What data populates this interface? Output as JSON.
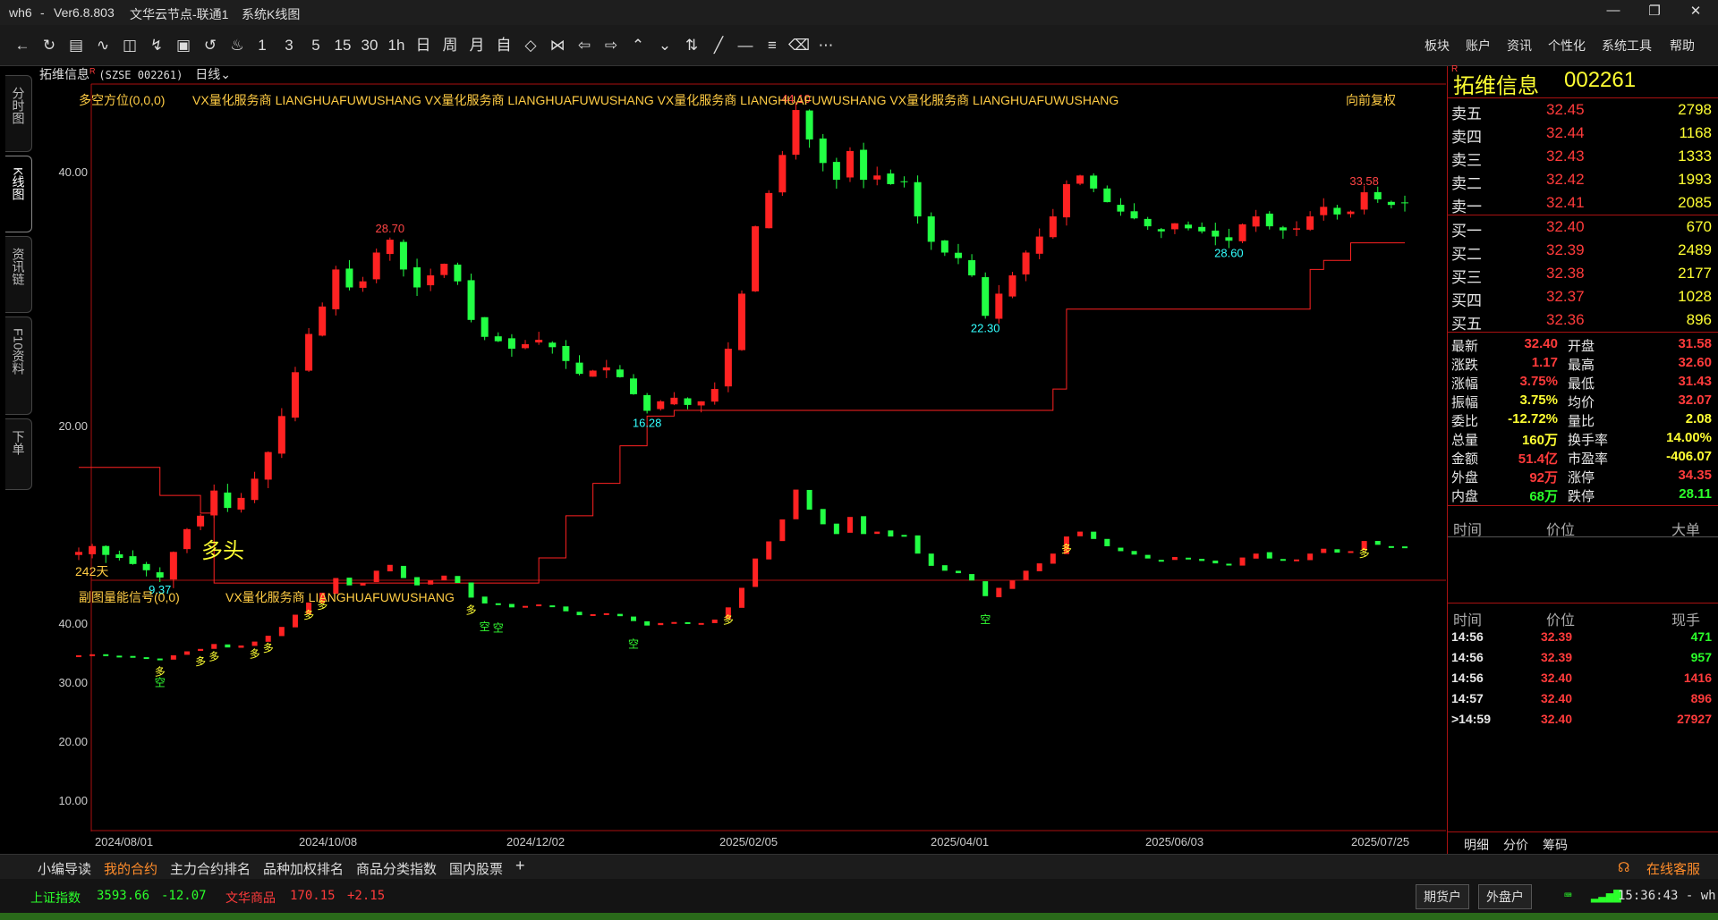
{
  "window": {
    "app": "wh6",
    "version": "Ver6.8.803",
    "node": "文华云节点-联通1",
    "view": "系统K线图",
    "min_icon": "minimize-icon",
    "max_icon": "restore-icon",
    "close_icon": "close-icon"
  },
  "toolbar": {
    "icons": [
      "back-icon",
      "refresh-icon",
      "list-icon",
      "line-chart-icon",
      "kline-icon",
      "draw-icon",
      "box-icon",
      "flash-icon",
      "bell-icon"
    ],
    "periods": [
      "1",
      "3",
      "5",
      "15",
      "30",
      "1h",
      "日",
      "周",
      "月",
      "自"
    ],
    "nav_icons": [
      "expand-icon",
      "contract-icon",
      "left-icon",
      "right-icon",
      "up-icon",
      "down-icon",
      "split-icon",
      "pen-icon",
      "minus-icon",
      "bracket-icon",
      "eraser-icon",
      "more-icon"
    ],
    "menus": [
      "板块",
      "账户",
      "资讯",
      "个性化",
      "系统工具",
      "帮助"
    ]
  },
  "sidetabs": [
    "分时图",
    "K线图",
    "资讯链",
    "F10资料",
    "下单"
  ],
  "header": {
    "name": "拓维信息",
    "flag": "R",
    "code": "(SZSE 002261)",
    "period": "日线"
  },
  "main_indicator": {
    "name": "多空方位(0,0,0)",
    "text": "VX量化服务商 LIANGHUAFUWUSHANG VX量化服务商 LIANGHUAFUWUSHANG VX量化服务商 LIANGHUAFUWUSHANG VX量化服务商 LIANGHUAFUWUSHANG",
    "right": "向前复权",
    "days": "242天",
    "signal": "多头",
    "marks": [
      "44.10",
      "28.70",
      "33.58",
      "22.30",
      "16.28",
      "28.60",
      "9.37"
    ],
    "yticks": [
      "40.00",
      "20.00"
    ]
  },
  "sub_indicator": {
    "name": "副图量能信号(0,0)",
    "text": "VX量化服务商 LIANGHUAFUWUSHANG",
    "yticks": [
      "40.00",
      "30.00",
      "20.00",
      "10.00"
    ],
    "buy": "多",
    "sell": "空"
  },
  "xaxis": [
    "2024/08/01",
    "2024/10/08",
    "2024/12/02",
    "2025/02/05",
    "2025/04/01",
    "2025/06/03",
    "2025/07/25"
  ],
  "chart_data": {
    "type": "candlestick",
    "title": "拓维信息 (SZSE 002261) 日线",
    "price_range": [
      8,
      48
    ],
    "high": 44.1,
    "low": 9.37,
    "annotations": [
      {
        "date": "2024/08",
        "value": 9.37
      },
      {
        "date": "2024/10",
        "value": 28.7
      },
      {
        "date": "2025/01",
        "value": 16.28
      },
      {
        "date": "2025/02",
        "value": 44.1
      },
      {
        "date": "2025/04",
        "value": 22.3
      },
      {
        "date": "2025/06",
        "value": 28.6
      },
      {
        "date": "2025/07",
        "value": 33.58
      }
    ],
    "xlabels": [
      "2024/08/01",
      "2024/10/08",
      "2024/12/02",
      "2025/02/05",
      "2025/04/01",
      "2025/06/03",
      "2025/07/25"
    ],
    "close_series": [
      10.2,
      10.4,
      10.1,
      10.0,
      9.8,
      9.6,
      9.37,
      10.2,
      11.0,
      11.5,
      12.5,
      11.8,
      12.2,
      13.0,
      14.2,
      16.0,
      18.5,
      21.0,
      23.0,
      26.0,
      24.5,
      25.0,
      27.5,
      28.7,
      26.0,
      24.5,
      25.5,
      26.5,
      25.0,
      22.0,
      20.8,
      20.5,
      20.0,
      20.3,
      20.6,
      20.1,
      19.2,
      18.4,
      18.6,
      18.8,
      18.2,
      17.2,
      16.28,
      16.8,
      17.0,
      16.6,
      16.8,
      17.5,
      20.0,
      24.0,
      30.0,
      33.5,
      38.0,
      44.1,
      40.0,
      37.0,
      35.0,
      38.5,
      35.0,
      35.5,
      34.5,
      34.8,
      31.0,
      28.5,
      27.5,
      27.0,
      25.5,
      22.3,
      24.0,
      25.5,
      27.5,
      29.0,
      31.0,
      34.5,
      35.5,
      34.0,
      32.5,
      31.5,
      30.8,
      30.0,
      29.5,
      30.3,
      29.8,
      29.5,
      29.0,
      28.6,
      30.2,
      31.0,
      30.0,
      29.6,
      29.8,
      31.0,
      32.0,
      31.2,
      31.5,
      33.58,
      32.8,
      32.2,
      32.4
    ],
    "stop_line": [
      {
        "d": 0,
        "v": 13.5
      },
      {
        "d": 6,
        "v": 12.3
      },
      {
        "d": 9,
        "v": 11.6
      },
      {
        "d": 10,
        "v": 9.2
      },
      {
        "d": 33,
        "v": 9.2
      },
      {
        "d": 34,
        "v": 10.0
      },
      {
        "d": 36,
        "v": 11.5
      },
      {
        "d": 38,
        "v": 12.8
      },
      {
        "d": 40,
        "v": 14.5
      },
      {
        "d": 42,
        "v": 16.0
      },
      {
        "d": 44,
        "v": 16.3
      },
      {
        "d": 70,
        "v": 16.3
      },
      {
        "d": 72,
        "v": 17.5
      },
      {
        "d": 73,
        "v": 22.8
      },
      {
        "d": 90,
        "v": 22.8
      },
      {
        "d": 91,
        "v": 26.0
      },
      {
        "d": 92,
        "v": 26.8
      },
      {
        "d": 94,
        "v": 28.4
      }
    ]
  },
  "quote": {
    "name": "拓维信息",
    "code": "002261",
    "flag": "R",
    "asks": [
      {
        "label": "卖五",
        "price": "32.45",
        "vol": "2798"
      },
      {
        "label": "卖四",
        "price": "32.44",
        "vol": "1168"
      },
      {
        "label": "卖三",
        "price": "32.43",
        "vol": "1333"
      },
      {
        "label": "卖二",
        "price": "32.42",
        "vol": "1993"
      },
      {
        "label": "卖一",
        "price": "32.41",
        "vol": "2085"
      }
    ],
    "bids": [
      {
        "label": "买一",
        "price": "32.40",
        "vol": "670"
      },
      {
        "label": "买二",
        "price": "32.39",
        "vol": "2489"
      },
      {
        "label": "买三",
        "price": "32.38",
        "vol": "2177"
      },
      {
        "label": "买四",
        "price": "32.37",
        "vol": "1028"
      },
      {
        "label": "买五",
        "price": "32.36",
        "vol": "896"
      }
    ],
    "stats": [
      {
        "l1": "最新",
        "v1": "32.40",
        "c1": "red",
        "l2": "开盘",
        "v2": "31.58",
        "c2": "red"
      },
      {
        "l1": "涨跌",
        "v1": "1.17",
        "c1": "red",
        "l2": "最高",
        "v2": "32.60",
        "c2": "red"
      },
      {
        "l1": "涨幅",
        "v1": "3.75%",
        "c1": "red",
        "l2": "最低",
        "v2": "31.43",
        "c2": "red"
      },
      {
        "l1": "振幅",
        "v1": "3.75%",
        "c1": "yellow",
        "l2": "均价",
        "v2": "32.07",
        "c2": "red"
      },
      {
        "l1": "委比",
        "v1": "-12.72%",
        "c1": "yellow",
        "l2": "量比",
        "v2": "2.08",
        "c2": "yellow"
      },
      {
        "l1": "总量",
        "v1": "160万",
        "c1": "yellow",
        "l2": "换手率",
        "v2": "14.00%",
        "c2": "yellow"
      },
      {
        "l1": "金额",
        "v1": "51.4亿",
        "c1": "red",
        "l2": "市盈率",
        "v2": "-406.07",
        "c2": "yellow"
      },
      {
        "l1": "外盘",
        "v1": "92万",
        "c1": "red",
        "l2": "涨停",
        "v2": "34.35",
        "c2": "red"
      },
      {
        "l1": "内盘",
        "v1": "68万",
        "c1": "green",
        "l2": "跌停",
        "v2": "28.11",
        "c2": "green"
      }
    ],
    "trades_head1": [
      "时间",
      "价位",
      "大单"
    ],
    "trades_head2": [
      "时间",
      "价位",
      "现手"
    ],
    "trades": [
      {
        "t": "14:56",
        "p": "32.39",
        "v": "471",
        "c": "green"
      },
      {
        "t": "14:56",
        "p": "32.39",
        "v": "957",
        "c": "green"
      },
      {
        "t": "14:56",
        "p": "32.40",
        "v": "1416",
        "c": "red"
      },
      {
        "t": "14:57",
        "p": "32.40",
        "v": "896",
        "c": "red"
      },
      {
        "t": ">14:59",
        "p": "32.40",
        "v": "27927",
        "c": "red"
      }
    ],
    "tabs": [
      "明细",
      "分价",
      "筹码"
    ]
  },
  "bottom_tabs": [
    "小编导读",
    "我的合约",
    "主力合约排名",
    "品种加权排名",
    "商品分类指数",
    "国内股票"
  ],
  "bottom_add": "+",
  "service": "在线客服",
  "status": {
    "idx1_name": "上证指数",
    "idx1_val": "3593.66",
    "idx1_chg": "-12.07",
    "idx2_name": "文华商品",
    "idx2_val": "170.15",
    "idx2_chg": "+2.15",
    "btn1": "期货户",
    "btn2": "外盘户",
    "time": "15:36:43 - wh"
  }
}
